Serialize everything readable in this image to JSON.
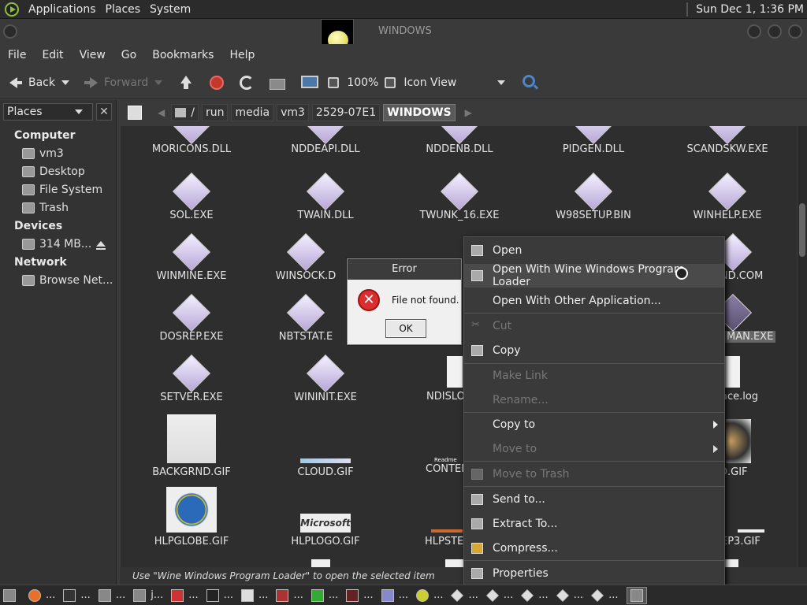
{
  "top_panel": {
    "menus": [
      "Applications",
      "Places",
      "System"
    ],
    "clock": "Sun Dec  1,  1:36 PM"
  },
  "window": {
    "title": "WINDOWS"
  },
  "menubar": [
    "File",
    "Edit",
    "View",
    "Go",
    "Bookmarks",
    "Help"
  ],
  "toolbar": {
    "back": "Back",
    "forward": "Forward",
    "zoom": "100%",
    "view_mode": "Icon View"
  },
  "sidebar": {
    "selector": "Places",
    "sections": [
      {
        "title": "Computer",
        "items": [
          "vm3",
          "Desktop",
          "File System",
          "Trash"
        ]
      },
      {
        "title": "Devices",
        "items": [
          "314 MB..."
        ]
      },
      {
        "title": "Network",
        "items": [
          "Browse Net..."
        ]
      }
    ]
  },
  "path": {
    "crumbs": [
      "/",
      "run",
      "media",
      "vm3",
      "2529-07E1",
      "WINDOWS"
    ]
  },
  "files": [
    "MORICONS.DLL",
    "NDDEAPI.DLL",
    "NDDENB.DLL",
    "PIDGEN.DLL",
    "SCANDSKW.EXE",
    "SOL.EXE",
    "TWAIN.DLL",
    "TWUNK_16.EXE",
    "W98SETUP.BIN",
    "WINHELP.EXE",
    "WINMINE.EXE",
    "WINSOCK.D",
    "AND.COM",
    "DOSREP.EXE",
    "NBTSTAT.E",
    "MAN.EXE",
    "SETVER.EXE",
    "WININIT.EXE",
    "NDISLO",
    "ace.log",
    "BACKGRND.GIF",
    "CLOUD.GIF",
    "CONTEN",
    "D.GIF",
    "HLPGLOBE.GIF",
    "HLPLOGO.GIF",
    "HLPSTE",
    "EP3.GIF"
  ],
  "file_images": {
    "hlplogo_text": "Microsoft",
    "content_text": "Readme"
  },
  "status": "Use \"Wine Windows Program Loader\" to open the selected item",
  "error_dialog": {
    "title": "Error",
    "message": "File not found.",
    "ok": "OK"
  },
  "context_menu": {
    "open": "Open",
    "open_with_wine": "Open With Wine Windows Program Loader",
    "open_with_other": "Open With Other Application...",
    "cut": "Cut",
    "copy": "Copy",
    "make_link": "Make Link",
    "rename": "Rename...",
    "copy_to": "Copy to",
    "move_to": "Move to",
    "move_to_trash": "Move to Trash",
    "send_to": "Send to...",
    "extract_to": "Extract To...",
    "compress": "Compress...",
    "properties": "Properties"
  },
  "taskbar": {
    "items": [
      "...",
      "...",
      "...",
      "j...",
      "...",
      "...",
      "...",
      "...",
      "...",
      "...",
      "...",
      "...",
      "...",
      "...",
      "...",
      "...",
      "..."
    ]
  }
}
